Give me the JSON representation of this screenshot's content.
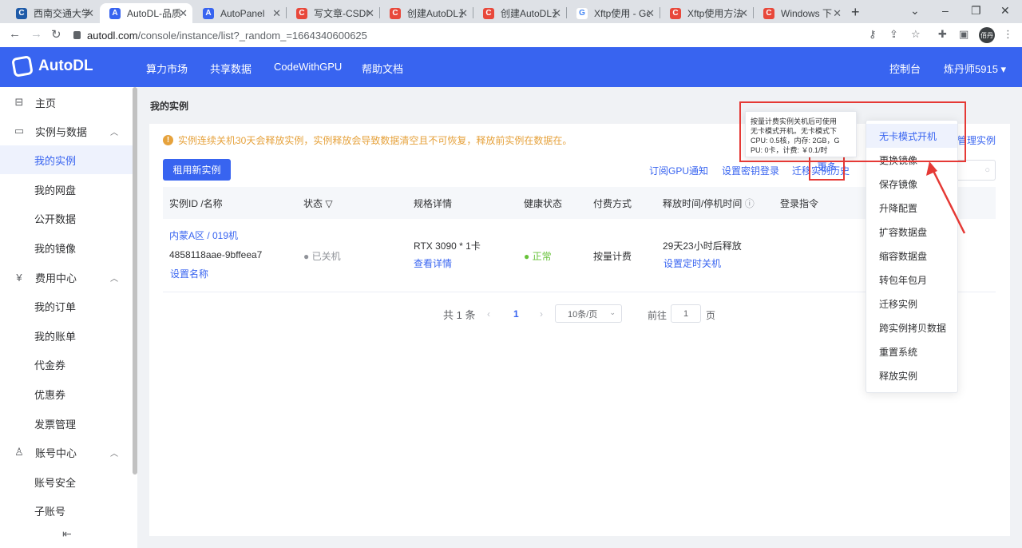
{
  "browser": {
    "tabs": [
      {
        "title": "西南交通大学",
        "favicon": "C",
        "favicon_color": "#1f5ba8"
      },
      {
        "title": "AutoDL-品质",
        "favicon": "A",
        "favicon_color": "#3864f0"
      },
      {
        "title": "AutoPanel",
        "favicon": "A",
        "favicon_color": "#3864f0"
      },
      {
        "title": "写文章-CSDN",
        "favicon": "C",
        "favicon_color": "#e8483b"
      },
      {
        "title": "创建AutoDL云",
        "favicon": "C",
        "favicon_color": "#e8483b"
      },
      {
        "title": "创建AutoDL云",
        "favicon": "C",
        "favicon_color": "#e8483b"
      },
      {
        "title": "Xftp使用 - Go",
        "favicon": "G",
        "favicon_color": "#4285f4"
      },
      {
        "title": "Xftp使用方法",
        "favicon": "C",
        "favicon_color": "#e8483b"
      },
      {
        "title": "Windows 下",
        "favicon": "C",
        "favicon_color": "#e8483b"
      }
    ],
    "url_host": "autodl.com",
    "url_path": "/console/instance/list?_random_=1664340600625",
    "profile_label": "佰丹"
  },
  "header": {
    "logo": "AutoDL",
    "nav": [
      "算力市场",
      "共享数据",
      "CodeWithGPU",
      "帮助文档"
    ],
    "console": "控制台",
    "user": "炼丹师5915 ▾"
  },
  "sidebar": {
    "home": "主页",
    "group_instances": "实例与数据",
    "my_instances": "我的实例",
    "my_disk": "我的网盘",
    "public_data": "公开数据",
    "my_images": "我的镜像",
    "group_billing": "费用中心",
    "my_orders": "我的订单",
    "my_bills": "我的账单",
    "vouchers": "代金券",
    "coupons": "优惠券",
    "invoices": "发票管理",
    "group_account": "账号中心",
    "account_security": "账号安全",
    "sub_accounts": "子账号"
  },
  "main": {
    "page_title": "我的实例",
    "notice": "实例连续关机30天会释放实例，实例释放会导致数据清空且不可恢复，释放前实例在数据在。",
    "manage_instances": "管理实例",
    "rent_button": "租用新实例",
    "subscribe_gpu": "订阅GPU通知",
    "set_ssh_key": "设置密钥登录",
    "migrate_history": "迁移实例历史",
    "columns": [
      "实例ID /名称",
      "状态",
      "规格详情",
      "健康状态",
      "付费方式",
      "释放时间/停机时间",
      "登录指令"
    ],
    "row": {
      "region": "内蒙A区 / 019机",
      "instance_id": "4858118aae-9bffeea7",
      "set_name": "设置名称",
      "status": "● 已关机",
      "spec": "RTX 3090 * 1卡",
      "view_details": "查看详情",
      "health": "● 正常",
      "billing": "按量计费",
      "release_time": "29天23小时后释放",
      "schedule_shutdown": "设置定时关机",
      "more": "更多"
    },
    "pagination": {
      "total": "共 1 条",
      "current_page": "1",
      "page_size": "10条/页",
      "goto_prefix": "前往",
      "goto_value": "1",
      "goto_suffix": "页"
    }
  },
  "tooltip": {
    "lines": [
      "按量计费实例关机后可使用",
      "无卡模式开机。无卡模式下",
      "CPU: 0.5核，内存: 2GB，G",
      "PU: 0卡，计费: ￥0.1/时"
    ]
  },
  "dropdown": {
    "items": [
      "无卡模式开机",
      "更换镜像",
      "保存镜像",
      "升降配置",
      "扩容数据盘",
      "缩容数据盘",
      "转包年包月",
      "迁移实例",
      "跨实例拷贝数据",
      "重置系统",
      "释放实例"
    ]
  }
}
